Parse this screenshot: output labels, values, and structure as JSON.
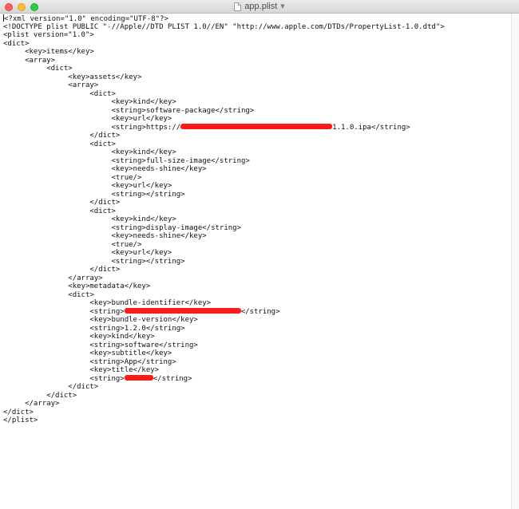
{
  "window": {
    "title": "app.plist"
  },
  "editor": {
    "lines": [
      "<?xml version=\"1.0\" encoding=\"UTF-8\"?>",
      "<!DOCTYPE plist PUBLIC \"-//Apple//DTD PLIST 1.0//EN\" \"http://www.apple.com/DTDs/PropertyList-1.0.dtd\">",
      "<plist version=\"1.0\">",
      "<dict>",
      "\t<key>items</key>",
      "\t<array>",
      "\t\t<dict>",
      "\t\t\t<key>assets</key>",
      "\t\t\t<array>",
      "\t\t\t\t<dict>",
      "\t\t\t\t\t<key>kind</key>",
      "\t\t\t\t\t<string>software-package</string>",
      "\t\t\t\t\t<key>url</key>",
      "\t\t\t\t\t<string>https://",
      "\t\t\t\t</dict>",
      "\t\t\t\t<dict>",
      "\t\t\t\t\t<key>kind</key>",
      "\t\t\t\t\t<string>full-size-image</string>",
      "\t\t\t\t\t<key>needs-shine</key>",
      "\t\t\t\t\t<true/>",
      "\t\t\t\t\t<key>url</key>",
      "\t\t\t\t\t<string></string>",
      "\t\t\t\t</dict>",
      "\t\t\t\t<dict>",
      "\t\t\t\t\t<key>kind</key>",
      "\t\t\t\t\t<string>display-image</string>",
      "\t\t\t\t\t<key>needs-shine</key>",
      "\t\t\t\t\t<true/>",
      "\t\t\t\t\t<key>url</key>",
      "\t\t\t\t\t<string></string>",
      "\t\t\t\t</dict>",
      "\t\t\t</array>",
      "\t\t\t<key>metadata</key>",
      "\t\t\t<dict>",
      "\t\t\t\t<key>bundle-identifier</key>",
      "\t\t\t\t<string>",
      "\t\t\t\t<key>bundle-version</key>",
      "\t\t\t\t<string>1.2.0</string>",
      "\t\t\t\t<key>kind</key>",
      "\t\t\t\t<string>software</string>",
      "\t\t\t\t<key>subtitle</key>",
      "\t\t\t\t<string>App</string>",
      "\t\t\t\t<key>title</key>",
      "\t\t\t\t<string>",
      "\t\t\t</dict>",
      "\t\t</dict>",
      "\t</array>",
      "</dict>",
      "</plist>"
    ],
    "url_suffix": "1.1.0.ipa</string>",
    "string_close": "</string>"
  },
  "colors": {
    "redaction": "#ff1a1a",
    "text": "#111111"
  },
  "icons": [
    "close-icon",
    "minimize-icon",
    "zoom-icon",
    "document-icon",
    "chevron-down-icon"
  ]
}
